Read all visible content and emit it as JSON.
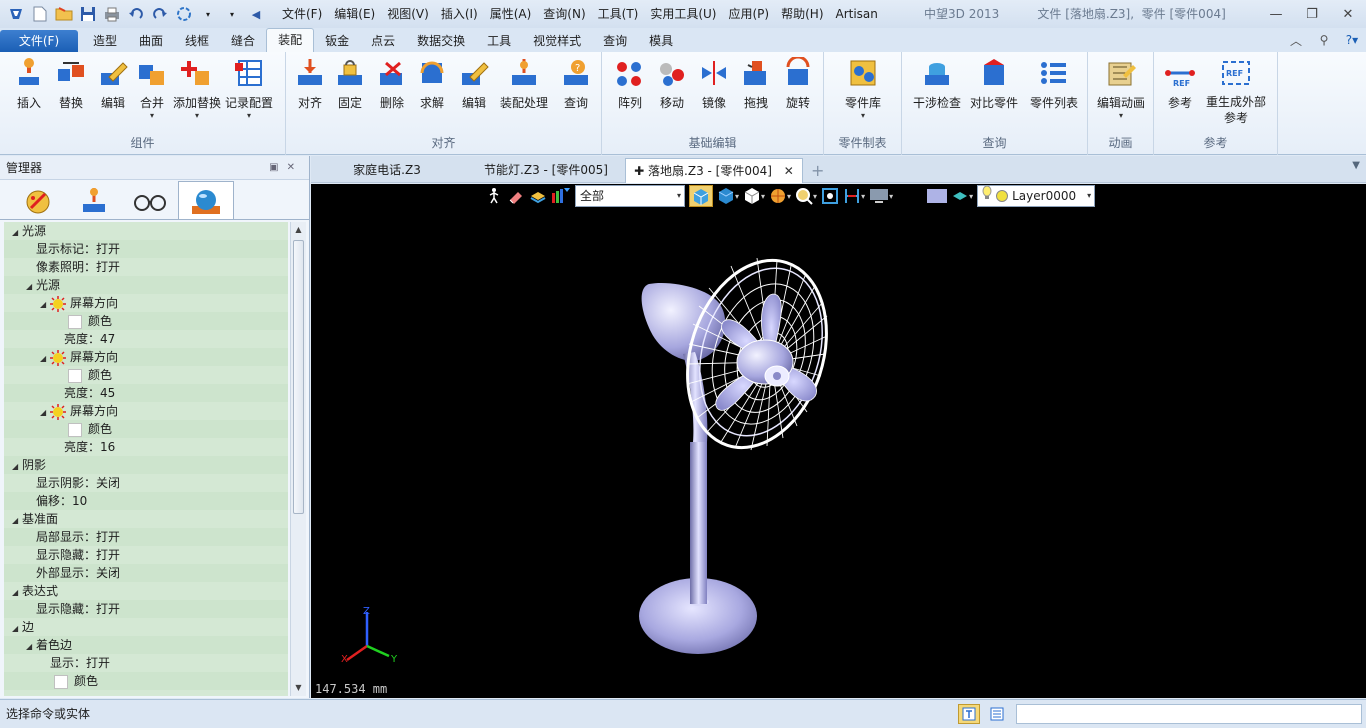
{
  "titlebar": {
    "menu": [
      "文件(F)",
      "编辑(E)",
      "视图(V)",
      "插入(I)",
      "属性(A)",
      "查询(N)",
      "工具(T)",
      "实用工具(U)",
      "应用(P)",
      "帮助(H)",
      "Artisan"
    ],
    "app_name": "中望3D 2013",
    "doc_info": "文件 [落地扇.Z3],  零件 [零件004]"
  },
  "tabs": [
    "文件(F)",
    "造型",
    "曲面",
    "线框",
    "缝合",
    "装配",
    "钣金",
    "点云",
    "数据交换",
    "工具",
    "视觉样式",
    "查询",
    "模具"
  ],
  "active_tab": "装配",
  "ribbon": {
    "groups": [
      {
        "label": "组件",
        "buttons": [
          "插入",
          "替换",
          "编辑",
          "合并",
          "添加替换",
          "记录配置"
        ]
      },
      {
        "label": "对齐",
        "buttons": [
          "对齐",
          "固定",
          "删除",
          "求解",
          "编辑",
          "装配处理",
          "查询"
        ]
      },
      {
        "label": "基础编辑",
        "buttons": [
          "阵列",
          "移动",
          "镜像",
          "拖拽",
          "旋转"
        ]
      },
      {
        "label": "零件制表",
        "buttons": [
          "零件库"
        ]
      },
      {
        "label": "查询",
        "buttons": [
          "干涉检查",
          "对比零件",
          "零件列表"
        ]
      },
      {
        "label": "动画",
        "buttons": [
          "编辑动画"
        ]
      },
      {
        "label": "参考",
        "buttons": [
          "参考",
          "重生成外部参考"
        ]
      }
    ]
  },
  "panel": {
    "title": "管理器",
    "tree": [
      {
        "level": 0,
        "toggle": true,
        "text": "光源"
      },
      {
        "level": 1,
        "text": "显示标记：打开"
      },
      {
        "level": 1,
        "text": "像素照明：打开"
      },
      {
        "level": 1,
        "toggle": true,
        "text": "光源"
      },
      {
        "level": 2,
        "toggle": true,
        "lamp": true,
        "text": "屏幕方向"
      },
      {
        "level": 3,
        "swatch": true,
        "text": "颜色"
      },
      {
        "level": 3,
        "text": "亮度：47"
      },
      {
        "level": 2,
        "toggle": true,
        "lamp": true,
        "text": "屏幕方向"
      },
      {
        "level": 3,
        "swatch": true,
        "text": "颜色"
      },
      {
        "level": 3,
        "text": "亮度：45"
      },
      {
        "level": 2,
        "toggle": true,
        "lamp": true,
        "text": "屏幕方向"
      },
      {
        "level": 3,
        "swatch": true,
        "text": "颜色"
      },
      {
        "level": 3,
        "text": "亮度：16"
      },
      {
        "level": 0,
        "toggle": true,
        "text": "阴影"
      },
      {
        "level": 1,
        "text": "显示阴影：关闭"
      },
      {
        "level": 1,
        "text": "偏移：10"
      },
      {
        "level": 0,
        "toggle": true,
        "text": "基准面"
      },
      {
        "level": 1,
        "text": "局部显示：打开"
      },
      {
        "level": 1,
        "text": "显示隐藏：打开"
      },
      {
        "level": 1,
        "text": "外部显示：关闭"
      },
      {
        "level": 0,
        "toggle": true,
        "text": "表达式"
      },
      {
        "level": 1,
        "text": "显示隐藏：打开"
      },
      {
        "level": 0,
        "toggle": true,
        "text": "边"
      },
      {
        "level": 1,
        "toggle": true,
        "text": "着色边"
      },
      {
        "level": 2,
        "text": "显示：打开"
      },
      {
        "level": 2,
        "swatch": true,
        "text": "颜色"
      }
    ]
  },
  "doc_tabs": [
    {
      "label": "家庭电话.Z3",
      "active": false
    },
    {
      "label": "节能灯.Z3 - [零件005]",
      "active": false
    },
    {
      "label": "落地扇.Z3 - [零件004]",
      "active": true
    }
  ],
  "viewport": {
    "filter": "全部",
    "layer": "Layer0000",
    "scale": "147.534 mm",
    "axes": [
      "X",
      "Y",
      "Z"
    ]
  },
  "status": {
    "message": "选择命令或实体"
  },
  "colors": {
    "ribbon_blue": "#1b5fb5",
    "tree_green": "#d4e8d4",
    "model_lavender": "#a6a6de"
  }
}
